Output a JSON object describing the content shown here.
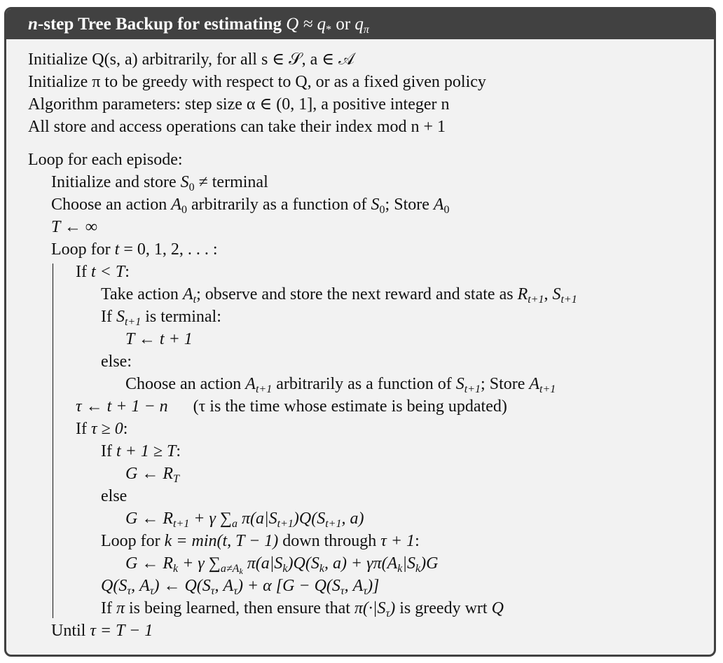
{
  "title": {
    "n": "n",
    "prefix": "-step Tree Backup for estimating ",
    "expr": "Q ≈ q",
    "star": "*",
    "or": " or ",
    "q": "q",
    "pi": "π"
  },
  "preamble": [
    "Initialize Q(s, a) arbitrarily, for all s ∈ 𝒮, a ∈ 𝒜",
    "Initialize π to be greedy with respect to Q, or as a fixed given policy",
    "Algorithm parameters: step size α ∈ (0, 1], a positive integer n",
    "All store and access operations can take their index mod n + 1"
  ],
  "body": {
    "l01": "Loop for each episode:",
    "l02a": "Initialize and store ",
    "l02b": "S",
    "l02c": "0",
    "l02d": " ≠ terminal",
    "l03a": "Choose an action ",
    "l03b": "A",
    "l03c": "0",
    "l03d": " arbitrarily as a function of ",
    "l03e": "S",
    "l03f": "0",
    "l03g": "; Store ",
    "l03h": "A",
    "l03i": "0",
    "l04": "T ← ∞",
    "l05a": "Loop for ",
    "l05b": "t",
    "l05c": " = 0, 1, 2, . . . :",
    "l06a": "If ",
    "l06b": "t < T",
    "l06c": ":",
    "l07a": "Take action ",
    "l07b": "A",
    "l07c": "t",
    "l07d": "; observe and store the next reward and state as ",
    "l07e": "R",
    "l07f": "t+1",
    "l07g": ", ",
    "l07h": "S",
    "l07i": "t+1",
    "l08a": "If ",
    "l08b": "S",
    "l08c": "t+1",
    "l08d": " is terminal:",
    "l09": "T ← t + 1",
    "l10": "else:",
    "l11a": "Choose an action ",
    "l11b": "A",
    "l11c": "t+1",
    "l11d": " arbitrarily as a function of ",
    "l11e": "S",
    "l11f": "t+1",
    "l11g": "; Store ",
    "l11h": "A",
    "l11i": "t+1",
    "l12a": "τ ← t + 1 − n",
    "l12b": "(τ is the time whose estimate is being updated)",
    "l13a": "If ",
    "l13b": "τ ≥ 0",
    "l13c": ":",
    "l14a": "If ",
    "l14b": "t + 1 ≥ T",
    "l14c": ":",
    "l15a": "G ← R",
    "l15b": "T",
    "l16": "else",
    "l17a": "G ← R",
    "l17b": "t+1",
    "l17c": " + γ ",
    "l17d": "∑",
    "l17e": "a",
    "l17f": " π(a|S",
    "l17g": "t+1",
    "l17h": ")Q(S",
    "l17i": "t+1",
    "l17j": ", a)",
    "l18a": "Loop for ",
    "l18b": "k = min(t, T − 1)",
    "l18c": " down through ",
    "l18d": "τ + 1",
    "l18e": ":",
    "l19a": "G ← R",
    "l19b": "k",
    "l19c": " + γ ",
    "l19d": "∑",
    "l19e": "a≠A",
    "l19f": "k",
    "l19g": " π(a|S",
    "l19h": "k",
    "l19i": ")Q(S",
    "l19j": "k",
    "l19k": ", a) + γπ(A",
    "l19l": "k",
    "l19m": "|S",
    "l19n": "k",
    "l19o": ")G",
    "l20a": "Q(S",
    "l20b": "τ",
    "l20c": ", A",
    "l20d": "τ",
    "l20e": ") ← Q(S",
    "l20f": "τ",
    "l20g": ", A",
    "l20h": "τ",
    "l20i": ") + α [G − Q(S",
    "l20j": "τ",
    "l20k": ", A",
    "l20l": "τ",
    "l20m": ")]",
    "l21a": "If ",
    "l21b": "π",
    "l21c": " is being learned, then ensure that ",
    "l21d": "π(·|S",
    "l21e": "τ",
    "l21f": ")",
    "l21g": " is greedy wrt ",
    "l21h": "Q",
    "l22a": "Until ",
    "l22b": "τ = T − 1"
  }
}
